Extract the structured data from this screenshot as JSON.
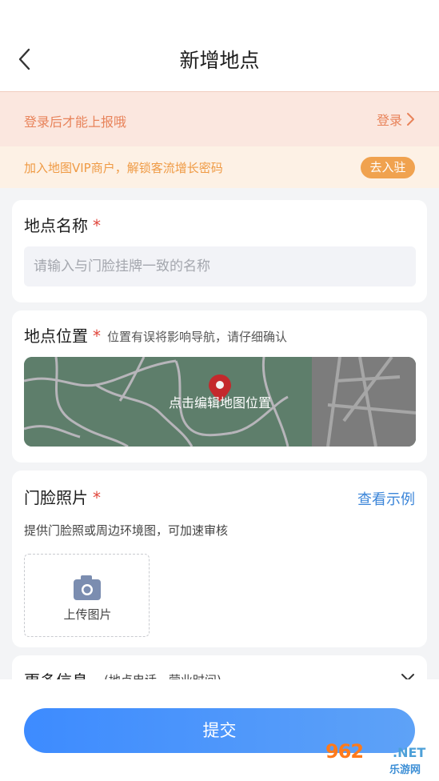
{
  "header": {
    "title": "新增地点"
  },
  "login_bar": {
    "text": "登录后才能上报哦",
    "link_label": "登录"
  },
  "vip_bar": {
    "text": "加入地图VIP商户，解锁客流增长密码",
    "button_label": "去入驻"
  },
  "name_section": {
    "label": "地点名称",
    "required_mark": "*",
    "placeholder": "请输入与门脸挂牌一致的名称"
  },
  "location_section": {
    "label": "地点位置",
    "required_mark": "*",
    "hint": "位置有误将影响导航，请仔细确认",
    "map_label": "点击编辑地图位置"
  },
  "photo_section": {
    "label": "门脸照片",
    "required_mark": "*",
    "example_link": "查看示例",
    "hint": "提供门脸照或周边环境图，可加速审核",
    "upload_label": "上传图片"
  },
  "more_section": {
    "label": "更多信息",
    "hint": "(地点电话、营业时间)"
  },
  "footer": {
    "submit_label": "提交"
  },
  "watermark": {
    "logo": "962",
    "net": ".NET",
    "cn": "乐游网"
  },
  "colors": {
    "accent": "#3d8bff",
    "warning": "#e8835a",
    "vip": "#f0a24f",
    "required": "#e0463c",
    "link": "#3c86d9"
  }
}
